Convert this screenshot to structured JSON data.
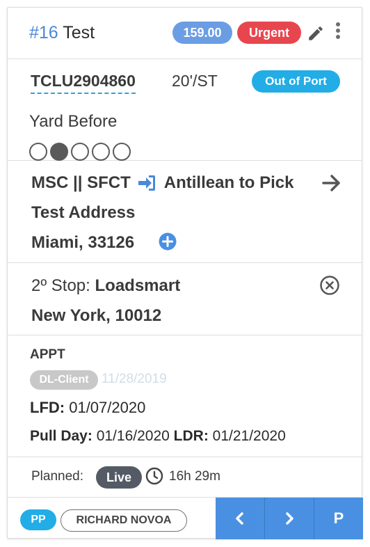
{
  "header": {
    "number": "#16",
    "title": "Test",
    "amount": "159.00",
    "priority": "Urgent"
  },
  "container": {
    "number": "TCLU2904860",
    "size": "20'/ST",
    "status": "Out of Port",
    "yard_label": "Yard Before",
    "progress": {
      "total": 5,
      "current": 2
    }
  },
  "route": {
    "terminal": "MSC || SFCT",
    "destination": "Antillean to Pick",
    "address": "Test Address",
    "city_zip": "Miami, 33126"
  },
  "stop": {
    "label": "2º Stop:",
    "name": "Loadsmart",
    "city_zip": "New York, 10012"
  },
  "appt": {
    "title": "APPT",
    "dl_badge": "DL-Client",
    "dl_date": "11/28/2019",
    "lfd_label": "LFD:",
    "lfd_value": "01/07/2020",
    "pull_label": "Pull Day:",
    "pull_value": "01/16/2020",
    "ldr_label": "LDR:",
    "ldr_value": "01/21/2020"
  },
  "planned": {
    "label": "Planned:",
    "mode": "Live",
    "duration": "16h 29m"
  },
  "footer": {
    "tag": "PP",
    "driver": "RICHARD NOVOA",
    "buttons": {
      "prev_icon": "chevron-left-icon",
      "next_icon": "chevron-right-icon",
      "p_label": "P"
    }
  },
  "colors": {
    "accent_blue": "#4a88d8",
    "urgent_red": "#e8464e",
    "status_cyan": "#22ade6",
    "nav_blue": "#4a90e2",
    "live_dark": "#545b64"
  }
}
